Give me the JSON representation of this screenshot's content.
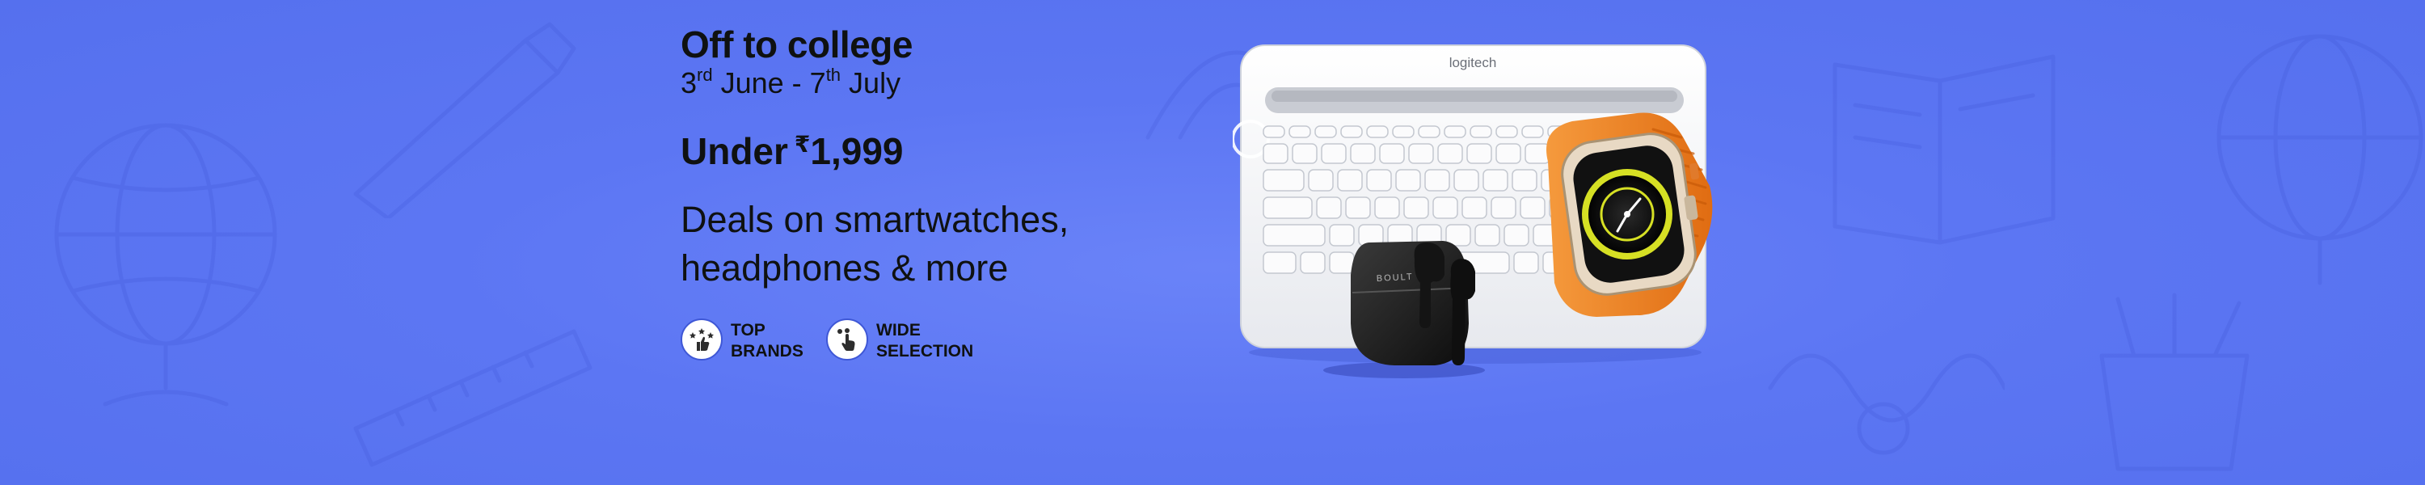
{
  "banner": {
    "headline": "Off to college",
    "dates": {
      "start_day": "3",
      "start_suffix": "rd",
      "start_month": " June - ",
      "end_day": "7",
      "end_suffix": "th",
      "end_month": " July"
    },
    "price": {
      "prefix": "Under",
      "currency": "₹",
      "amount": "1,999"
    },
    "description": "Deals on smartwatches, headphones & more",
    "badges": [
      {
        "icon": "stars-thumbs-up-icon",
        "line1": "TOP",
        "line2": "BRANDS"
      },
      {
        "icon": "tap-hand-icon",
        "line1": "WIDE",
        "line2": "SELECTION"
      }
    ],
    "products": {
      "keyboard_brand": "logitech",
      "earbuds_brand": "BOULT"
    },
    "colors": {
      "background": "#5c76f3",
      "watch_strap": "#f07f23",
      "text": "#0f1111"
    }
  }
}
